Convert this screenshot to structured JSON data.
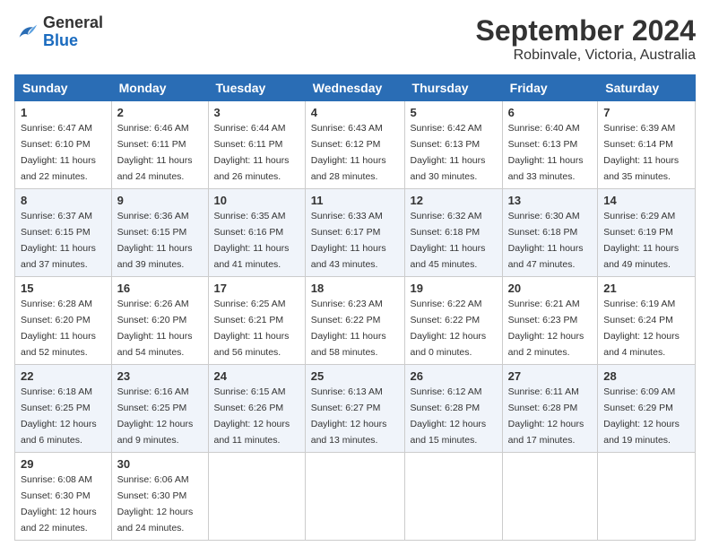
{
  "header": {
    "logo_general": "General",
    "logo_blue": "Blue",
    "month_title": "September 2024",
    "location": "Robinvale, Victoria, Australia"
  },
  "weekdays": [
    "Sunday",
    "Monday",
    "Tuesday",
    "Wednesday",
    "Thursday",
    "Friday",
    "Saturday"
  ],
  "weeks": [
    [
      {
        "day": "1",
        "info": "Sunrise: 6:47 AM\nSunset: 6:10 PM\nDaylight: 11 hours\nand 22 minutes."
      },
      {
        "day": "2",
        "info": "Sunrise: 6:46 AM\nSunset: 6:11 PM\nDaylight: 11 hours\nand 24 minutes."
      },
      {
        "day": "3",
        "info": "Sunrise: 6:44 AM\nSunset: 6:11 PM\nDaylight: 11 hours\nand 26 minutes."
      },
      {
        "day": "4",
        "info": "Sunrise: 6:43 AM\nSunset: 6:12 PM\nDaylight: 11 hours\nand 28 minutes."
      },
      {
        "day": "5",
        "info": "Sunrise: 6:42 AM\nSunset: 6:13 PM\nDaylight: 11 hours\nand 30 minutes."
      },
      {
        "day": "6",
        "info": "Sunrise: 6:40 AM\nSunset: 6:13 PM\nDaylight: 11 hours\nand 33 minutes."
      },
      {
        "day": "7",
        "info": "Sunrise: 6:39 AM\nSunset: 6:14 PM\nDaylight: 11 hours\nand 35 minutes."
      }
    ],
    [
      {
        "day": "8",
        "info": "Sunrise: 6:37 AM\nSunset: 6:15 PM\nDaylight: 11 hours\nand 37 minutes."
      },
      {
        "day": "9",
        "info": "Sunrise: 6:36 AM\nSunset: 6:15 PM\nDaylight: 11 hours\nand 39 minutes."
      },
      {
        "day": "10",
        "info": "Sunrise: 6:35 AM\nSunset: 6:16 PM\nDaylight: 11 hours\nand 41 minutes."
      },
      {
        "day": "11",
        "info": "Sunrise: 6:33 AM\nSunset: 6:17 PM\nDaylight: 11 hours\nand 43 minutes."
      },
      {
        "day": "12",
        "info": "Sunrise: 6:32 AM\nSunset: 6:18 PM\nDaylight: 11 hours\nand 45 minutes."
      },
      {
        "day": "13",
        "info": "Sunrise: 6:30 AM\nSunset: 6:18 PM\nDaylight: 11 hours\nand 47 minutes."
      },
      {
        "day": "14",
        "info": "Sunrise: 6:29 AM\nSunset: 6:19 PM\nDaylight: 11 hours\nand 49 minutes."
      }
    ],
    [
      {
        "day": "15",
        "info": "Sunrise: 6:28 AM\nSunset: 6:20 PM\nDaylight: 11 hours\nand 52 minutes."
      },
      {
        "day": "16",
        "info": "Sunrise: 6:26 AM\nSunset: 6:20 PM\nDaylight: 11 hours\nand 54 minutes."
      },
      {
        "day": "17",
        "info": "Sunrise: 6:25 AM\nSunset: 6:21 PM\nDaylight: 11 hours\nand 56 minutes."
      },
      {
        "day": "18",
        "info": "Sunrise: 6:23 AM\nSunset: 6:22 PM\nDaylight: 11 hours\nand 58 minutes."
      },
      {
        "day": "19",
        "info": "Sunrise: 6:22 AM\nSunset: 6:22 PM\nDaylight: 12 hours\nand 0 minutes."
      },
      {
        "day": "20",
        "info": "Sunrise: 6:21 AM\nSunset: 6:23 PM\nDaylight: 12 hours\nand 2 minutes."
      },
      {
        "day": "21",
        "info": "Sunrise: 6:19 AM\nSunset: 6:24 PM\nDaylight: 12 hours\nand 4 minutes."
      }
    ],
    [
      {
        "day": "22",
        "info": "Sunrise: 6:18 AM\nSunset: 6:25 PM\nDaylight: 12 hours\nand 6 minutes."
      },
      {
        "day": "23",
        "info": "Sunrise: 6:16 AM\nSunset: 6:25 PM\nDaylight: 12 hours\nand 9 minutes."
      },
      {
        "day": "24",
        "info": "Sunrise: 6:15 AM\nSunset: 6:26 PM\nDaylight: 12 hours\nand 11 minutes."
      },
      {
        "day": "25",
        "info": "Sunrise: 6:13 AM\nSunset: 6:27 PM\nDaylight: 12 hours\nand 13 minutes."
      },
      {
        "day": "26",
        "info": "Sunrise: 6:12 AM\nSunset: 6:28 PM\nDaylight: 12 hours\nand 15 minutes."
      },
      {
        "day": "27",
        "info": "Sunrise: 6:11 AM\nSunset: 6:28 PM\nDaylight: 12 hours\nand 17 minutes."
      },
      {
        "day": "28",
        "info": "Sunrise: 6:09 AM\nSunset: 6:29 PM\nDaylight: 12 hours\nand 19 minutes."
      }
    ],
    [
      {
        "day": "29",
        "info": "Sunrise: 6:08 AM\nSunset: 6:30 PM\nDaylight: 12 hours\nand 22 minutes."
      },
      {
        "day": "30",
        "info": "Sunrise: 6:06 AM\nSunset: 6:30 PM\nDaylight: 12 hours\nand 24 minutes."
      },
      null,
      null,
      null,
      null,
      null
    ]
  ]
}
